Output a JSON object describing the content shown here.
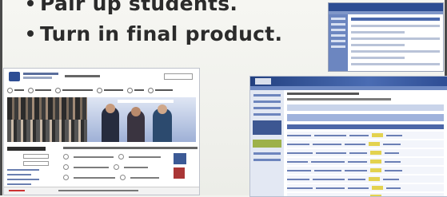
{
  "slide": {
    "bullets": [
      "Pair up students.",
      "Turn in final product."
    ]
  },
  "thumbnails": [
    {
      "name": "course-site-screenshot"
    },
    {
      "name": "university-portal-screenshot"
    },
    {
      "name": "assignment-table-screenshot"
    }
  ]
}
